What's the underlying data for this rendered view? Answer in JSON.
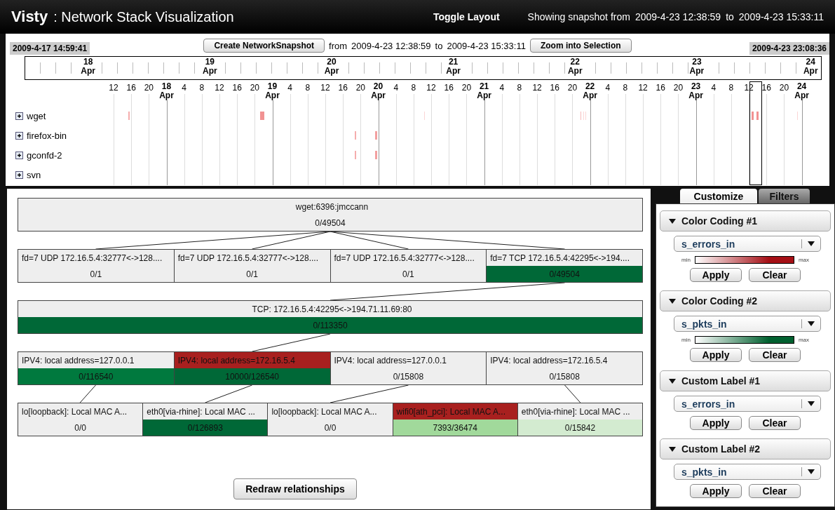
{
  "header": {
    "app_name": "Visty",
    "title": ": Network Stack Visualization",
    "toggle": "Toggle Layout",
    "snapshot_label": "Showing snapshot from",
    "snapshot_from": "2009-4-23 12:38:59",
    "snapshot_to_label": "to",
    "snapshot_to": "2009-4-23 15:33:11"
  },
  "controls": {
    "range_start": "2009-4-17 14:59:41",
    "create_button": "Create NetworkSnapshot",
    "from_label": "from",
    "from": "2009-4-23 12:38:59",
    "to_label": "to",
    "to": "2009-4-23 15:33:11",
    "zoom_button": "Zoom into Selection",
    "range_end": "2009-4-23 23:08:36"
  },
  "overview": {
    "days": [
      {
        "day": "18",
        "month": "Apr"
      },
      {
        "day": "19",
        "month": "Apr"
      },
      {
        "day": "20",
        "month": "Apr"
      },
      {
        "day": "21",
        "month": "Apr"
      },
      {
        "day": "22",
        "month": "Apr"
      },
      {
        "day": "23",
        "month": "Apr"
      },
      {
        "day": "24",
        "month": "Apr"
      }
    ]
  },
  "timeline": {
    "ticks": [
      {
        "kind": "hour",
        "label": "12"
      },
      {
        "kind": "hour",
        "label": "16"
      },
      {
        "kind": "hour",
        "label": "20"
      },
      {
        "kind": "day",
        "day": "18",
        "month": "Apr"
      },
      {
        "kind": "hour",
        "label": "4"
      },
      {
        "kind": "hour",
        "label": "8"
      },
      {
        "kind": "hour",
        "label": "12"
      },
      {
        "kind": "hour",
        "label": "16"
      },
      {
        "kind": "hour",
        "label": "20"
      },
      {
        "kind": "day",
        "day": "19",
        "month": "Apr"
      },
      {
        "kind": "hour",
        "label": "4"
      },
      {
        "kind": "hour",
        "label": "8"
      },
      {
        "kind": "hour",
        "label": "12"
      },
      {
        "kind": "hour",
        "label": "16"
      },
      {
        "kind": "hour",
        "label": "20"
      },
      {
        "kind": "day",
        "day": "20",
        "month": "Apr"
      },
      {
        "kind": "hour",
        "label": "4"
      },
      {
        "kind": "hour",
        "label": "8"
      },
      {
        "kind": "hour",
        "label": "12"
      },
      {
        "kind": "hour",
        "label": "16"
      },
      {
        "kind": "hour",
        "label": "20"
      },
      {
        "kind": "day",
        "day": "21",
        "month": "Apr"
      },
      {
        "kind": "hour",
        "label": "4"
      },
      {
        "kind": "hour",
        "label": "8"
      },
      {
        "kind": "hour",
        "label": "12"
      },
      {
        "kind": "hour",
        "label": "16"
      },
      {
        "kind": "hour",
        "label": "20"
      },
      {
        "kind": "day",
        "day": "22",
        "month": "Apr"
      },
      {
        "kind": "hour",
        "label": "4"
      },
      {
        "kind": "hour",
        "label": "8"
      },
      {
        "kind": "hour",
        "label": "12"
      },
      {
        "kind": "hour",
        "label": "16"
      },
      {
        "kind": "hour",
        "label": "20"
      },
      {
        "kind": "day",
        "day": "23",
        "month": "Apr"
      },
      {
        "kind": "hour",
        "label": "4"
      },
      {
        "kind": "hour",
        "label": "8"
      },
      {
        "kind": "hour",
        "label": "12"
      },
      {
        "kind": "hour",
        "label": "16"
      },
      {
        "kind": "hour",
        "label": "20"
      },
      {
        "kind": "day",
        "day": "24",
        "month": "Apr"
      }
    ],
    "rows": [
      {
        "name": "wget",
        "expanded": false
      },
      {
        "name": "firefox-bin",
        "expanded": false
      },
      {
        "name": "gconfd-2",
        "expanded": false
      },
      {
        "name": "svn",
        "expanded": false
      }
    ]
  },
  "graph": {
    "root": {
      "header": {
        "text": "wget:6396:jmccann",
        "color": "#eeeeee"
      },
      "metric": {
        "text": "0/49504",
        "color": "#eeeeee"
      },
      "children": [
        {
          "header": {
            "text": "fd=7 UDP 172.16.5.4:32777<->128....",
            "color": "#eeeeee"
          },
          "metric": {
            "text": "0/1",
            "color": "#eeeeee"
          },
          "linked": true
        },
        {
          "header": {
            "text": "fd=7 UDP 172.16.5.4:32777<->128....",
            "color": "#eeeeee"
          },
          "metric": {
            "text": "0/1",
            "color": "#eeeeee"
          },
          "linked": true
        },
        {
          "header": {
            "text": "fd=7 UDP 172.16.5.4:32777<->128....",
            "color": "#eeeeee"
          },
          "metric": {
            "text": "0/1",
            "color": "#eeeeee"
          },
          "linked": true
        },
        {
          "header": {
            "text": "fd=7 TCP 172.16.5.4:42295<->194....",
            "color": "#eeeeee"
          },
          "metric": {
            "text": "0/49504",
            "color": "#006837"
          },
          "linked": true,
          "children": [
            {
              "header": {
                "text": "TCP: 172.16.5.4:42295<->194.71.11.69:80",
                "color": "#eeeeee"
              },
              "metric": {
                "text": "0/113350",
                "color": "#006837"
              },
              "linked": true,
              "children": [
                {
                  "header": {
                    "text": "IPV4: local address=127.0.0.1",
                    "color": "#eeeeee"
                  },
                  "metric": {
                    "text": "0/116540",
                    "color": "#00793e"
                  },
                  "linked": false,
                  "children": [
                    {
                      "header": {
                        "text": "lo[loopback]: Local MAC A...",
                        "color": "#eeeeee"
                      },
                      "metric": {
                        "text": "0/0",
                        "color": "#eeeeee"
                      },
                      "linked": true
                    }
                  ]
                },
                {
                  "header": {
                    "text": "IPV4: local address=172.16.5.4",
                    "color": "#a8201f"
                  },
                  "metric": {
                    "text": "10000/126540",
                    "color": "#006837"
                  },
                  "linked": true,
                  "children": [
                    {
                      "header": {
                        "text": "eth0[via-rhine]: Local MAC ...",
                        "color": "#eeeeee"
                      },
                      "metric": {
                        "text": "0/126893",
                        "color": "#006837"
                      },
                      "linked": true
                    }
                  ]
                },
                {
                  "header": {
                    "text": "IPV4: local address=127.0.0.1",
                    "color": "#eeeeee"
                  },
                  "metric": {
                    "text": "0/15808",
                    "color": "#eeeeee"
                  },
                  "linked": false,
                  "children": [
                    {
                      "header": {
                        "text": "lo[loopback]: Local MAC A...",
                        "color": "#eeeeee"
                      },
                      "metric": {
                        "text": "0/0",
                        "color": "#eeeeee"
                      },
                      "linked": true
                    }
                  ]
                },
                {
                  "header": {
                    "text": "IPV4: local address=172.16.5.4",
                    "color": "#eeeeee"
                  },
                  "metric": {
                    "text": "0/15808",
                    "color": "#eeeeee"
                  },
                  "linked": false,
                  "children": [
                    {
                      "header": {
                        "text": "wifi0[ath_pci]: Local MAC A...",
                        "color": "#a8201f"
                      },
                      "metric": {
                        "text": "7393/36474",
                        "color": "#a1d99b"
                      },
                      "linked": false
                    },
                    {
                      "header": {
                        "text": "eth0[via-rhine]: Local MAC ...",
                        "color": "#eeeeee"
                      },
                      "metric": {
                        "text": "0/15842",
                        "color": "#d3ebd0"
                      },
                      "linked": true
                    }
                  ]
                }
              ]
            }
          ]
        }
      ]
    },
    "button": "Redraw relationships"
  },
  "side_panel": {
    "tabs": [
      {
        "label": "Customize",
        "selected": true
      },
      {
        "label": "Filters",
        "selected": false
      }
    ],
    "sections": [
      {
        "kind": "color",
        "title": "Color Coding #1",
        "expanded": true,
        "field": "s_errors_in",
        "min_label": "min",
        "max_label": "max",
        "color": "#a50f15",
        "apply": "Apply",
        "clear": "Clear"
      },
      {
        "kind": "color",
        "title": "Color Coding #2",
        "expanded": true,
        "field": "s_pkts_in",
        "min_label": "min",
        "max_label": "max",
        "color": "#00602f",
        "apply": "Apply",
        "clear": "Clear"
      },
      {
        "kind": "label",
        "title": "Custom Label #1",
        "expanded": true,
        "field": "s_errors_in",
        "apply": "Apply",
        "clear": "Clear"
      },
      {
        "kind": "label",
        "title": "Custom Label #2",
        "expanded": true,
        "field": "s_pkts_in",
        "apply": "Apply",
        "clear": "Clear"
      }
    ]
  }
}
